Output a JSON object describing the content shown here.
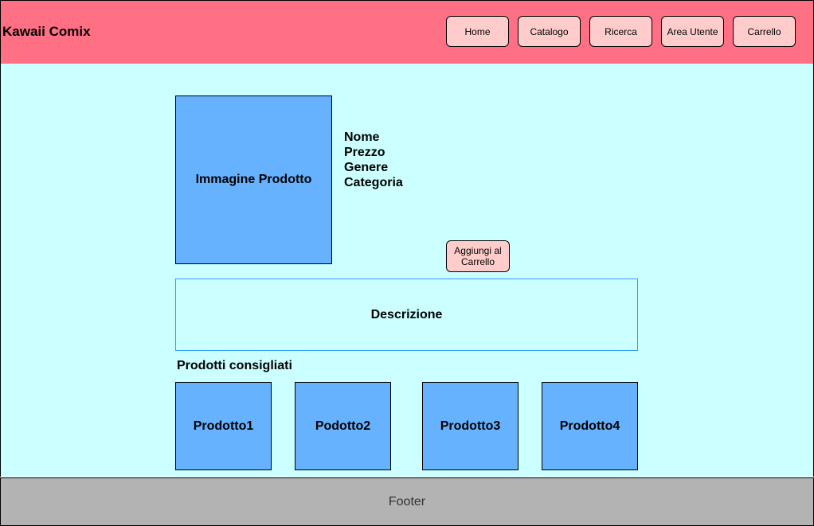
{
  "header": {
    "brand": "Kawaii Comix",
    "nav": [
      "Home",
      "Catalogo",
      "Ricerca",
      "Area Utente",
      "Carrello"
    ]
  },
  "product": {
    "image_label": "Immagine Prodotto",
    "info": [
      "Nome",
      "Prezzo",
      "Genere",
      "Categoria"
    ],
    "add_to_cart": "Aggiungi al Carrello",
    "description": "Descrizione"
  },
  "recommended": {
    "title": "Prodotti consigliati",
    "items": [
      "Prodotto1",
      "Podotto2",
      "Prodotto3",
      "Prodotto4"
    ]
  },
  "footer": {
    "label": "Footer"
  }
}
